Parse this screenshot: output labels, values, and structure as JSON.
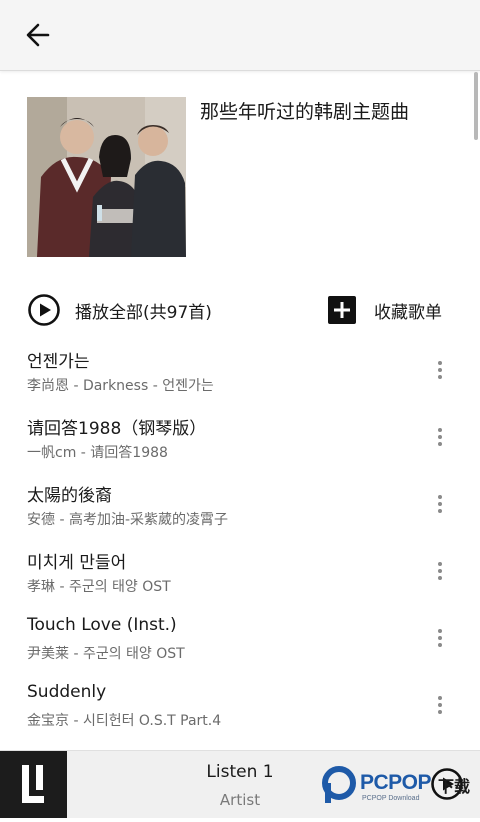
{
  "header": {
    "back_icon": "arrow-left-icon"
  },
  "playlist": {
    "title": "那些年听过的韩剧主题曲",
    "cover_icon": "album-cover-image"
  },
  "actions": {
    "play_all_label": "播放全部(共97首)",
    "play_all_icon": "play-circle-icon",
    "collect_label": "收藏歌单",
    "collect_icon": "plus-square-icon"
  },
  "songs": [
    {
      "title": "언젠가는",
      "subtitle": "李尚恩 - Darkness - 언젠가는"
    },
    {
      "title": "请回答1988（钢琴版）",
      "subtitle": "一帆cm - 请回答1988"
    },
    {
      "title": "太陽的後裔",
      "subtitle": "安德 - 高考加油-采紫葳的凌霄子"
    },
    {
      "title": "미치게 만들어",
      "subtitle": "孝琳 - 주군의 태양 OST"
    },
    {
      "title": "Touch Love (Inst.)",
      "subtitle": "尹美莱 - 주군의 태양 OST"
    },
    {
      "title": "Suddenly",
      "subtitle": "金宝京 - 시티헌터 O.S.T Part.4"
    }
  ],
  "player": {
    "title": "Listen 1",
    "artist": "Artist",
    "play_icon": "play-circle-icon"
  },
  "watermark": {
    "brand": "PCPOP",
    "sub": "PCPOP Download",
    "cn": "下载"
  },
  "colors": {
    "topbar": "#f5f5f5",
    "player_bg": "#f0f0f0",
    "logo_bg": "#1c1c1c",
    "watermark_blue": "#1e5aa8"
  }
}
